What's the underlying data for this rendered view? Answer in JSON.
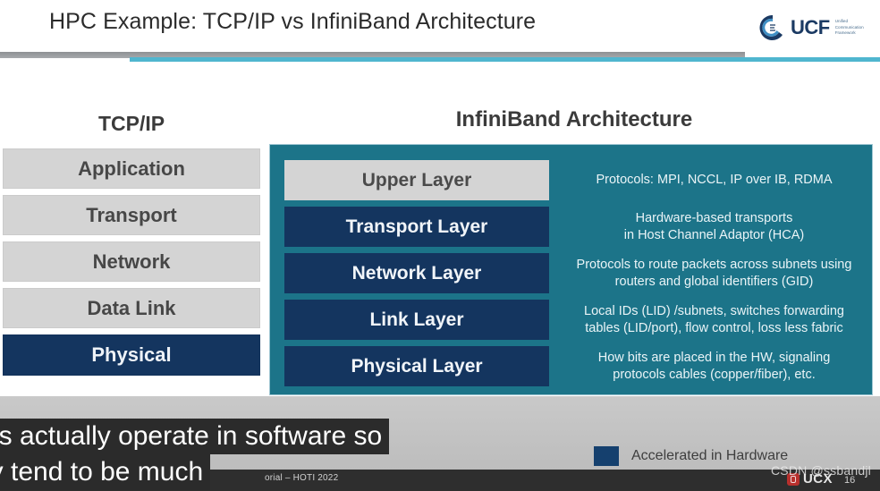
{
  "header": {
    "title": "HPC Example: TCP/IP vs InfiniBand Architecture",
    "logo": {
      "wordmark": "UCF",
      "tagline": "Unified\nCommunication\nFramework",
      "icon": "ucf-circle-logo"
    }
  },
  "columns": {
    "tcp_title": "TCP/IP",
    "ib_title": "InfiniBand Architecture"
  },
  "tcp_stack": [
    {
      "label": "Application",
      "accelerated": false
    },
    {
      "label": "Transport",
      "accelerated": false
    },
    {
      "label": "Network",
      "accelerated": false
    },
    {
      "label": "Data Link",
      "accelerated": false
    },
    {
      "label": "Physical",
      "accelerated": true
    }
  ],
  "ib_stack": [
    {
      "label": "Upper Layer",
      "accelerated": false,
      "description": "Protocols: MPI, NCCL, IP over IB, RDMA"
    },
    {
      "label": "Transport Layer",
      "accelerated": true,
      "description": "Hardware-based transports\nin Host Channel Adaptor (HCA)"
    },
    {
      "label": "Network Layer",
      "accelerated": true,
      "description": "Protocols to route packets across subnets using\nrouters and global identifiers (GID)"
    },
    {
      "label": "Link Layer",
      "accelerated": true,
      "description": "Local IDs (LID) /subnets, switches forwarding\ntables (LID/port), flow control, loss less fabric"
    },
    {
      "label": "Physical Layer",
      "accelerated": true,
      "description": "How bits are placed in the HW, signaling\nprotocols cables (copper/fiber), etc."
    }
  ],
  "legend": {
    "swatch_color": "#15406e",
    "label": "Accelerated in Hardware"
  },
  "caption": {
    "line1": "ers actually operate in software so",
    "line2": "ey tend to be much"
  },
  "footer": {
    "deck_text": "orial – HOTI 2022",
    "brand": "UCX",
    "page_number": "16"
  },
  "watermark": {
    "text": "CSDN @ssbandjl"
  },
  "colors": {
    "teal_panel": "#1c7489",
    "navy_layer": "#14355f",
    "gray_layer": "#d4d4d4",
    "rule_cyan": "#4fb6cf",
    "rule_gray": "#9a9d a0"
  }
}
